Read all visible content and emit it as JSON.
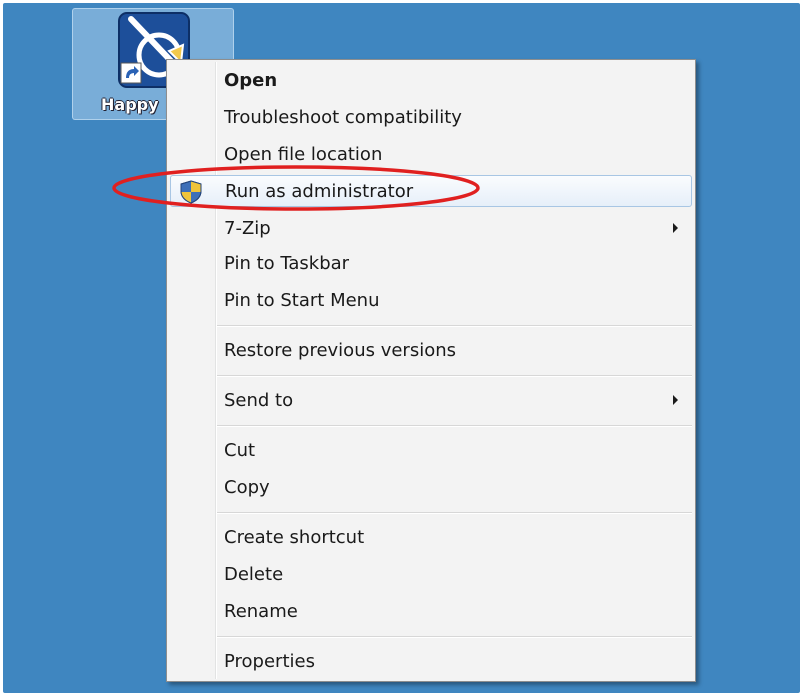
{
  "desktop": {
    "background": "#3f86c0",
    "shortcut": {
      "label": "Happy",
      "icon": "app-shortcut-icon"
    }
  },
  "context_menu": {
    "items": [
      {
        "label": "Open",
        "bold": true
      },
      {
        "label": "Troubleshoot compatibility"
      },
      {
        "label": "Open file location"
      },
      {
        "label": "Run as administrator",
        "icon": "uac-shield-icon",
        "highlighted": true
      },
      {
        "label": "7-Zip",
        "submenu": true
      },
      {
        "label": "Pin to Taskbar"
      },
      {
        "label": "Pin to Start Menu"
      },
      {
        "label": "Restore previous versions"
      },
      {
        "label": "Send to",
        "submenu": true
      },
      {
        "label": "Cut"
      },
      {
        "label": "Copy"
      },
      {
        "label": "Create shortcut"
      },
      {
        "label": "Delete"
      },
      {
        "label": "Rename"
      },
      {
        "label": "Properties"
      }
    ]
  },
  "annotation": {
    "ring_color": "#e02020",
    "target": "Run as administrator"
  }
}
